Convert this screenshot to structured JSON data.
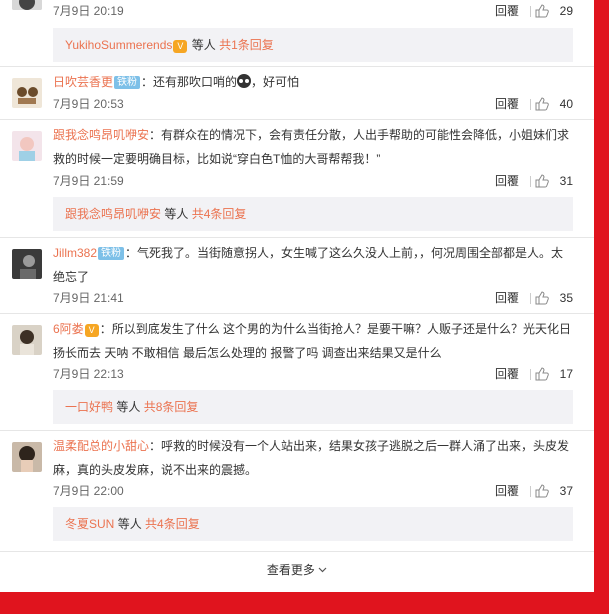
{
  "comments": [
    {
      "time": "7月9日 20:19",
      "reply_label": "回覆",
      "likes": "29",
      "sub": {
        "user": "YukihoSummerends",
        "mid": "等人",
        "count": "共1条回复"
      }
    },
    {
      "user": "日吹芸香更",
      "badge": "铁粉",
      "text_before": "：还有那吹口哨的",
      "text_after": "，好可怕",
      "time": "7月9日 20:53",
      "reply_label": "回覆",
      "likes": "40"
    },
    {
      "user": "跟我念鸣昂叽咿安",
      "text": "：有群众在的情况下，会有责任分散，人出手帮助的可能性会降低，小姐妹们求救的时候一定要明确目标，比如说“穿白色T恤的大哥帮帮我！”",
      "time": "7月9日 21:59",
      "reply_label": "回覆",
      "likes": "31",
      "sub": {
        "user": "跟我念鸣昂叽咿安",
        "mid": "等人",
        "count": "共4条回复"
      }
    },
    {
      "user": "Jillm382",
      "badge": "铁粉",
      "text": "：气死我了。当街随意拐人，女生喊了这么久没人上前，，何况周围全部都是人。太绝忘了",
      "time": "7月9日 21:41",
      "reply_label": "回覆",
      "likes": "35"
    },
    {
      "user": "6阿娄",
      "text": "：所以到底发生了什么 这个男的为什么当街抢人？是要干嘛？人贩子还是什么？光天化日 扬长而去 天呐 不敢相信 最后怎么处理的 报警了吗 调查出来结果又是什么",
      "time": "7月9日 22:13",
      "reply_label": "回覆",
      "likes": "17",
      "sub": {
        "user": "一口好鸭",
        "mid": "等人",
        "count": "共8条回复"
      }
    },
    {
      "user": "温柔配总的小甜心",
      "text": "：呼救的时候没有一个人站出来，结果女孩子逃脱之后一群人涌了出来，头皮发麻，真的头皮发麻，说不出来的震撼。",
      "time": "7月9日 22:00",
      "reply_label": "回覆",
      "likes": "37",
      "sub": {
        "user": "冬夏SUN",
        "mid": "等人",
        "count": "共4条回复"
      }
    }
  ],
  "more_label": "查看更多",
  "colors": {
    "username": "#eb7350",
    "border": "#e0141e",
    "badge": "#7dc0e8"
  }
}
